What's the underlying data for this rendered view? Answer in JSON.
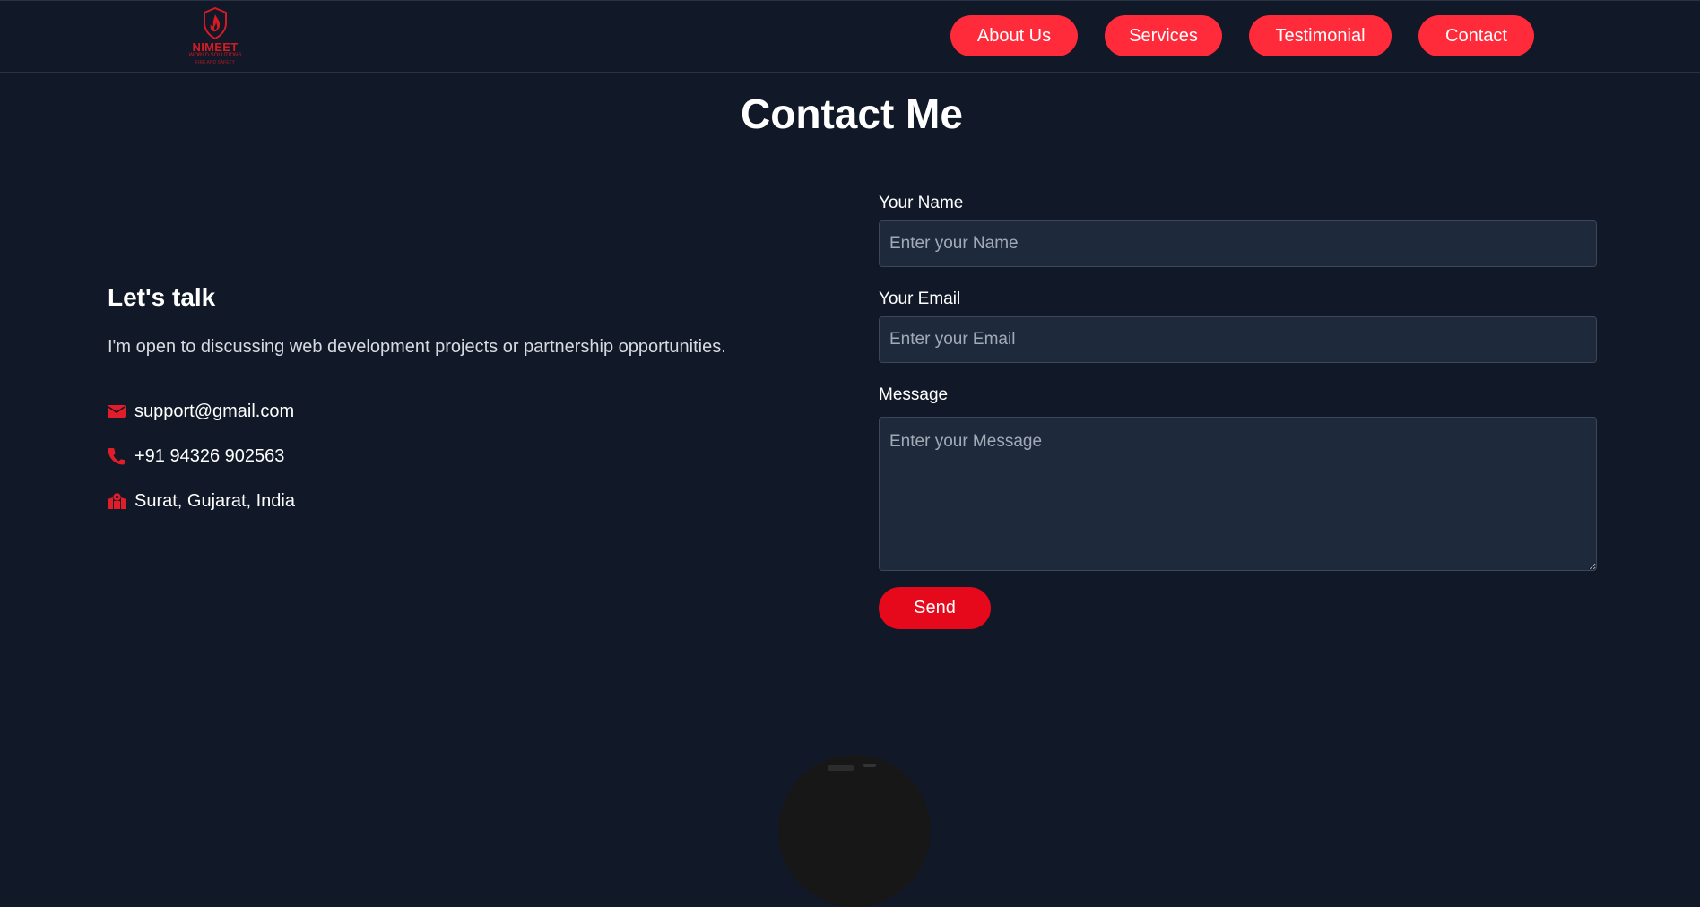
{
  "header": {
    "logo": {
      "name": "NIMEET",
      "subtitle": "WORLD SOLUTIONS",
      "tagline": "FIRE AND SAFETY",
      "icon": "flame-shield-icon"
    },
    "nav": [
      {
        "label": "About Us"
      },
      {
        "label": "Services"
      },
      {
        "label": "Testimonial"
      },
      {
        "label": "Contact"
      }
    ]
  },
  "page": {
    "title": "Contact Me"
  },
  "contact_info": {
    "heading": "Let's talk",
    "intro": "I'm open to discussing web development projects or partnership opportunities.",
    "items": [
      {
        "icon": "envelope-icon",
        "text": "support@gmail.com"
      },
      {
        "icon": "phone-icon",
        "text": "+91 94326 902563"
      },
      {
        "icon": "map-location-icon",
        "text": "Surat, Gujarat, India"
      }
    ]
  },
  "form": {
    "name": {
      "label": "Your Name",
      "placeholder": "Enter your Name",
      "value": ""
    },
    "email": {
      "label": "Your Email",
      "placeholder": "Enter your Email",
      "value": ""
    },
    "message": {
      "label": "Message",
      "placeholder": "Enter your Message",
      "value": ""
    },
    "submit_label": "Send"
  },
  "colors": {
    "background": "#111827",
    "accent": "#ff2a3a",
    "send_button": "#e5091b",
    "input_background": "#1e293b",
    "icon_red": "#e11d2a"
  }
}
